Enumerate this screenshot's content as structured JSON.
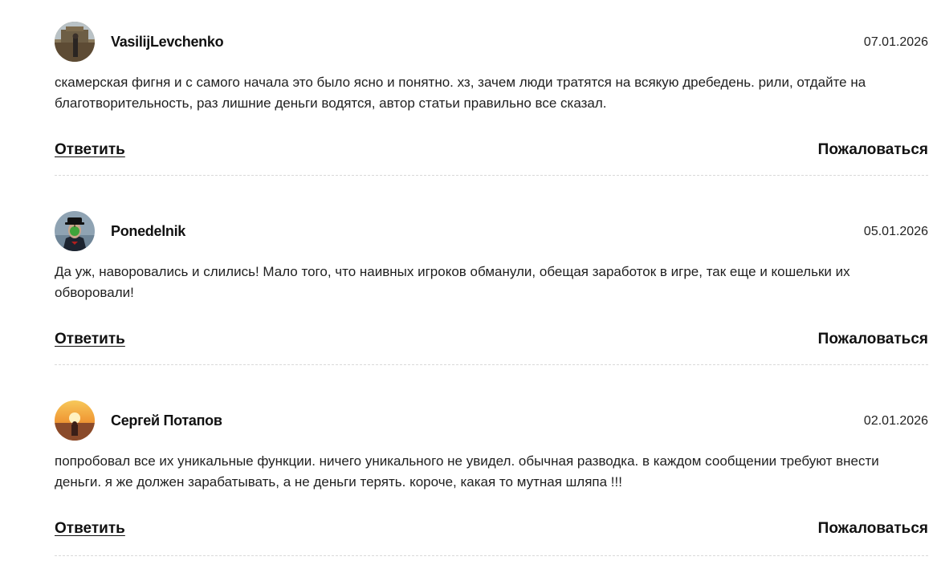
{
  "comments": [
    {
      "author": "VasilijLevchenko",
      "date": "07.01.2026",
      "avatar": "avatar-icon-city-photo",
      "text": "скамерская фигня и с самого начала это было ясно и понятно. хз, зачем люди тратятся на всякую дребедень. рили, отдайте на благотворительность, раз лишние деньги водятся, автор статьи правильно все сказал.",
      "reply_label": "Ответить",
      "report_label": "Пожаловаться"
    },
    {
      "author": "Ponedelnik",
      "date": "05.01.2026",
      "avatar": "avatar-icon-man-with-apple",
      "text": "Да уж, наворовались и слились! Мало того, что наивных игроков обманули, обещая заработок в игре, так еще и кошельки их обворовали!",
      "reply_label": "Ответить",
      "report_label": "Пожаловаться"
    },
    {
      "author": "Сергей Потапов",
      "date": "02.01.2026",
      "avatar": "avatar-icon-sunset-photo",
      "text": "попробовал все их уникальные функции. ничего уникального не увидел. обычная разводка. в каждом сообщении требуют внести деньги. я же должен зарабатывать, а не деньги терять. короче, какая то мутная шляпа !!!",
      "reply_label": "Ответить",
      "report_label": "Пожаловаться"
    }
  ],
  "colors": {
    "text": "#1a1a1a",
    "divider": "#d9d9d9",
    "background": "#ffffff"
  }
}
